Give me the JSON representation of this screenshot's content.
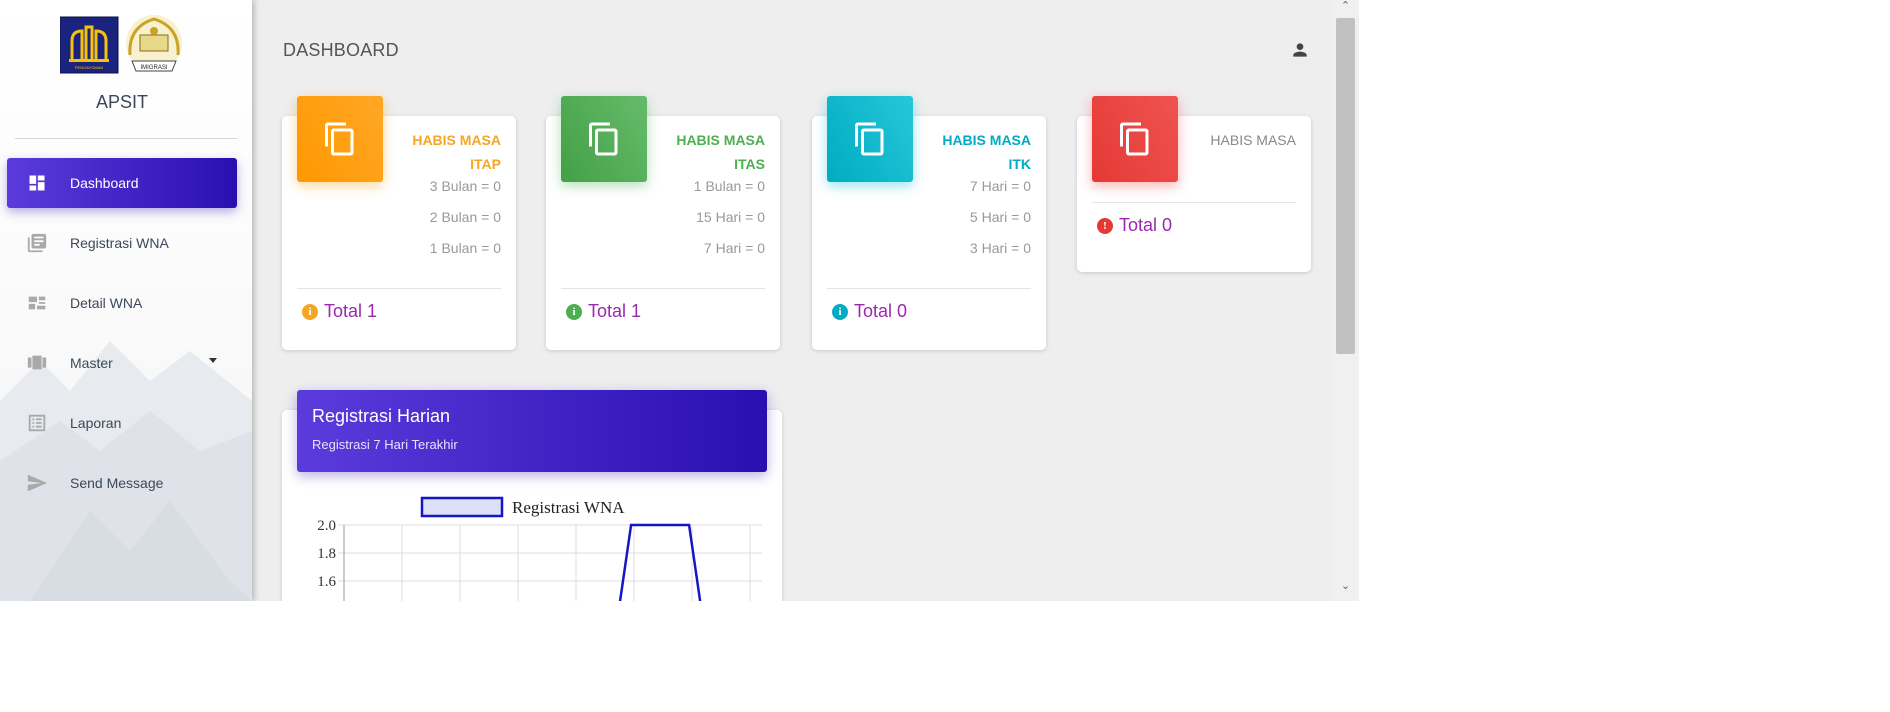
{
  "sidebar": {
    "brand": "APSIT",
    "logo_text": [
      "PENGAYOMAN",
      "IMIGRASI"
    ],
    "items": [
      {
        "label": "Dashboard",
        "icon": "dashboard-icon",
        "active": true
      },
      {
        "label": "Registrasi WNA",
        "icon": "library-books-icon"
      },
      {
        "label": "Detail WNA",
        "icon": "dashboard-split-icon"
      },
      {
        "label": "Master",
        "icon": "view-carousel-icon",
        "has_dropdown": true
      },
      {
        "label": "Laporan",
        "icon": "list-alt-icon"
      },
      {
        "label": "Send Message",
        "icon": "send-icon"
      }
    ]
  },
  "header": {
    "title": "DASHBOARD",
    "user_icon": "person-icon"
  },
  "cards": [
    {
      "title_line1": "HABIS MASA",
      "title_line2": "ITAP",
      "color": "#f5a623",
      "rows": [
        "3 Bulan = 0",
        "2 Bulan = 0",
        "1 Bulan = 0"
      ],
      "total_label": "Total",
      "total_value": "1",
      "status_color": "#f5a623"
    },
    {
      "title_line1": "HABIS MASA",
      "title_line2": "ITAS",
      "color": "#4caf50",
      "rows": [
        "1 Bulan = 0",
        "15 Hari = 0",
        "7 Hari = 0"
      ],
      "total_label": "Total",
      "total_value": "1",
      "status_color": "#4caf50"
    },
    {
      "title_line1": "HABIS MASA",
      "title_line2": "ITK",
      "color": "#00acc1",
      "rows": [
        "7 Hari = 0",
        "5 Hari = 0",
        "3 Hari = 0"
      ],
      "total_label": "Total",
      "total_value": "0",
      "status_color": "#00acc1"
    },
    {
      "title_line1": "HABIS MASA",
      "title_line2": "",
      "color": "#e53935",
      "rows": [],
      "total_label": "Total",
      "total_value": "0",
      "status_color": "#e53935"
    }
  ],
  "registrasi": {
    "title": "Registrasi Harian",
    "subtitle": "Registrasi 7 Hari Terakhir"
  },
  "chart_data": {
    "type": "line",
    "series": [
      {
        "name": "Registrasi WNA",
        "color": "#1515c8",
        "visible_points": [
          [
            4.75,
            1.5
          ],
          [
            4.95,
            2.0
          ],
          [
            5.95,
            2.0
          ],
          [
            6.15,
            1.5
          ]
        ]
      }
    ],
    "yticks": [
      2.0,
      1.8,
      1.6
    ],
    "ylim": [
      1.5,
      2.0
    ],
    "legend": "top-center",
    "grid": true
  }
}
